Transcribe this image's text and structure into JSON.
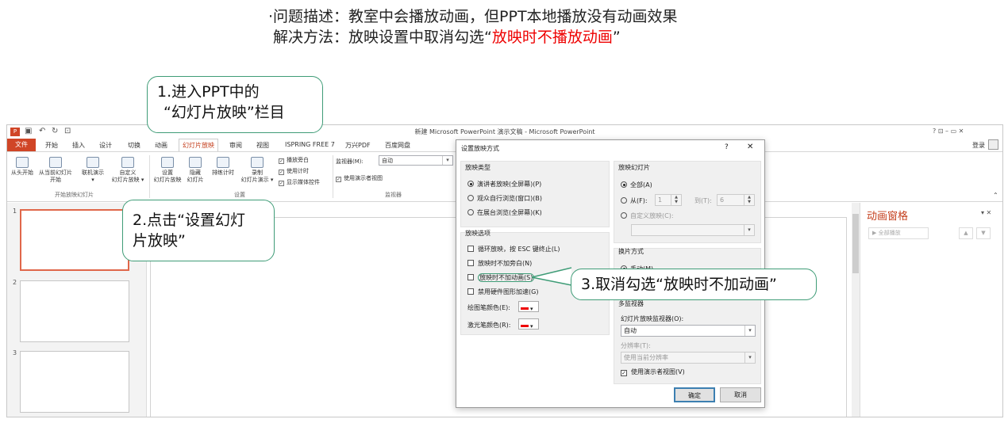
{
  "desc": {
    "line1": "·问题描述：教室中会播放动画，但PPT本地播放没有动画效果",
    "line2a": "解决方法：放映设置中取消勾选“",
    "line2b": "放映时不播放动画",
    "line2c": "”"
  },
  "callouts": {
    "c1a": "1.进入PPT中的",
    "c1b": "“幻灯片放映”栏目",
    "c2a": "2.点击“设置幻灯",
    "c2b": "片放映”",
    "c3": "3.取消勾选“放映时不加动画”"
  },
  "window": {
    "title": "新建 Microsoft PowerPoint 演示文稿 - Microsoft PowerPoint",
    "login": "登录",
    "win_controls": "?   ⊡   –   ▭   ✕"
  },
  "tabs": {
    "file": "文件",
    "t1": "开始",
    "t2": "插入",
    "t3": "设计",
    "t4": "切换",
    "t5": "动画",
    "t6": "幻灯片放映",
    "t7": "审阅",
    "t8": "视图",
    "t9": "ISPRING FREE 7",
    "t10": "万兴PDF",
    "t11": "百度网盘"
  },
  "ribbon": {
    "b1": "从头开始",
    "b2a": "从当前幻灯片",
    "b2b": "开始",
    "b3a": "联机演示",
    "b3b": "▾",
    "b4a": "自定义",
    "b4b": "幻灯片放映 ▾",
    "g1": "开始放映幻灯片",
    "b5a": "设置",
    "b5b": "幻灯片放映",
    "b6a": "隐藏",
    "b6b": "幻灯片",
    "b7": "排练计时",
    "b8a": "录制",
    "b8b": "幻灯片演示 ▾",
    "c1": "播放旁白",
    "c2": "使用计时",
    "c3": "显示媒体控件",
    "g2": "设置",
    "mon_label": "监视器(M):",
    "mon_val": "自动",
    "presenter": "使用演示者视图",
    "g3": "监视器"
  },
  "thumbs": {
    "n1": "1",
    "n2": "2",
    "n3": "3"
  },
  "anim": {
    "title": "动画窗格",
    "play": "▶ 全部播放",
    "close": "▾ ✕"
  },
  "dialog": {
    "title": "设置放映方式",
    "help": "?",
    "close": "✕",
    "type_title": "放映类型",
    "r1": "演讲者放映(全屏幕)(P)",
    "r2": "观众自行浏览(窗口)(B)",
    "r3": "在展台浏览(全屏幕)(K)",
    "opt_title": "放映选项",
    "o1": "循环放映，按 ESC 键终止(L)",
    "o2": "放映时不加旁白(N)",
    "o3": "放映时不加动画(S)",
    "o4": "禁用硬件图形加速(G)",
    "pen": "绘图笔颜色(E):",
    "laser": "激光笔颜色(R):",
    "slides_title": "放映幻灯片",
    "all": "全部(A)",
    "from": "从(F):",
    "from_val": "1",
    "to": "到(T):",
    "to_val": "6",
    "custom": "自定义放映(C):",
    "adv_title": "换片方式",
    "manual": "手动(M)",
    "mm_title": "多监视器",
    "mon_label": "幻灯片放映监视器(O):",
    "mon_val": "自动",
    "res_label": "分辨率(T):",
    "res_val": "使用当前分辨率",
    "presenter": "使用演示者视图(V)",
    "ok": "确定",
    "cancel": "取消"
  },
  "colors": {
    "accent": "#c43e1c",
    "callout_border": "#3f9c77",
    "red": "#e00000"
  }
}
